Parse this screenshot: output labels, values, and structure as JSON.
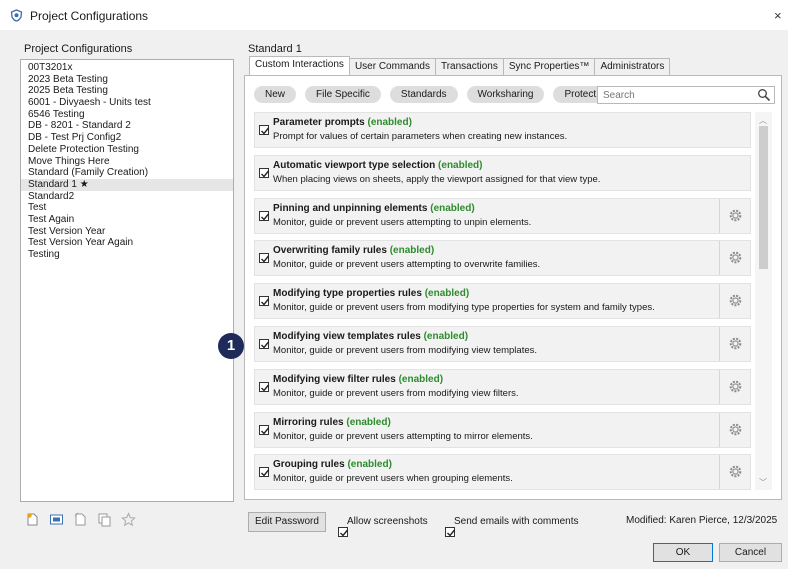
{
  "window": {
    "title": "Project Configurations",
    "close_glyph": "×"
  },
  "left": {
    "label": "Project Configurations",
    "items": [
      "00T3201x",
      "2023 Beta Testing",
      "2025 Beta Testing",
      "6001 - Divyaesh - Units test",
      "6546 Testing",
      "DB - 8201 - Standard 2",
      "DB - Test Prj Config2",
      "Delete Protection Testing",
      "Move Things Here",
      "Standard (Family Creation)",
      "Standard 1 ★",
      "Standard2",
      "Test",
      "Test Again",
      "Test Version Year",
      "Test Version Year Again",
      "Testing"
    ],
    "selected_index": 10,
    "footer_icons": [
      "new-config-icon",
      "import-icon",
      "copy-icon",
      "duplicate-icon",
      "favorite-star-icon"
    ]
  },
  "main": {
    "label": "Standard 1",
    "tabs": [
      "Custom Interactions",
      "User Commands",
      "Transactions",
      "Sync Properties™",
      "Administrators"
    ],
    "active_tab": 0,
    "filters": [
      "New",
      "File Specific",
      "Standards",
      "Worksharing",
      "Protect"
    ],
    "search_placeholder": "Search",
    "rules": [
      {
        "title": "Parameter prompts",
        "status": "(enabled)",
        "desc": "Prompt for values of certain parameters when creating new instances.",
        "gear": false
      },
      {
        "title": "Automatic viewport type selection",
        "status": "(enabled)",
        "desc": "When placing views on sheets, apply the viewport assigned for that view type.",
        "gear": false
      },
      {
        "title": "Pinning and unpinning elements",
        "status": "(enabled)",
        "desc": "Monitor, guide or prevent users attempting to unpin elements.",
        "gear": true
      },
      {
        "title": "Overwriting family rules",
        "status": "(enabled)",
        "desc": "Monitor, guide or prevent users attempting to overwrite families.",
        "gear": true
      },
      {
        "title": "Modifying type properties rules",
        "status": "(enabled)",
        "desc": "Monitor, guide or prevent users from modifying type properties for system and family types.",
        "gear": true
      },
      {
        "title": "Modifying view templates rules",
        "status": "(enabled)",
        "desc": "Monitor, guide or prevent users from modifying view templates.",
        "gear": true
      },
      {
        "title": "Modifying view filter rules",
        "status": "(enabled)",
        "desc": "Monitor, guide or prevent users from modifying view filters.",
        "gear": true
      },
      {
        "title": "Mirroring rules",
        "status": "(enabled)",
        "desc": "Monitor, guide or prevent users attempting to mirror elements.",
        "gear": true
      },
      {
        "title": "Grouping rules",
        "status": "(enabled)",
        "desc": "Monitor, guide or prevent users when grouping elements.",
        "gear": true
      }
    ],
    "callout_number": "1"
  },
  "footer": {
    "edit_password": "Edit Password",
    "allow_screenshots": "Allow screenshots",
    "send_emails": "Send emails with comments",
    "modified": "Modified: Karen Pierce, 12/3/2025",
    "ok": "OK",
    "cancel": "Cancel"
  },
  "colors": {
    "enabled": "#2e8b2e",
    "callout": "#1d2a5a",
    "app_icon": "#3a6fb0"
  }
}
